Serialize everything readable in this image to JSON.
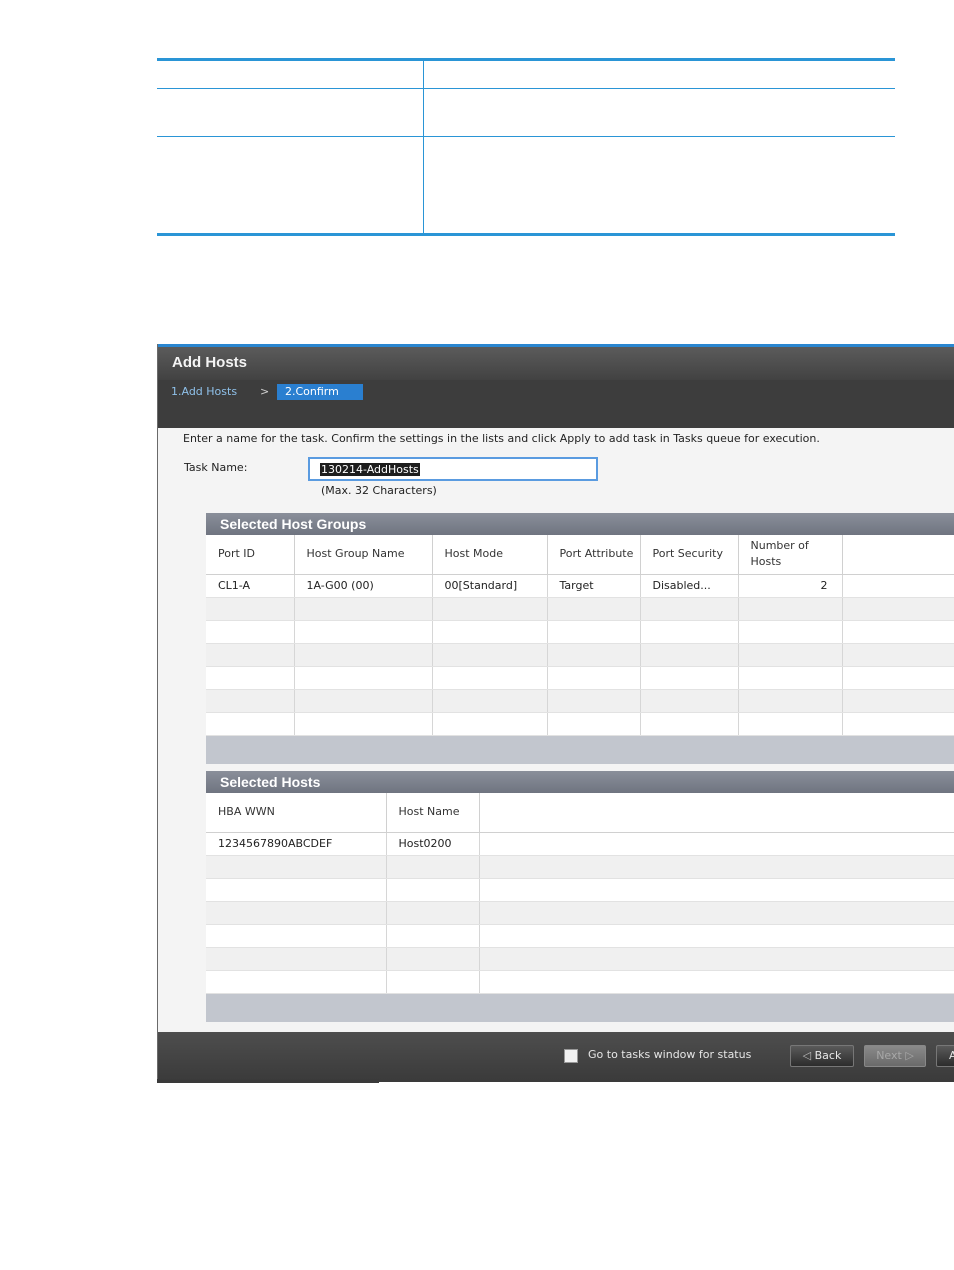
{
  "dialog": {
    "title": "Add Hosts",
    "steps": {
      "step1": "1.Add Hosts",
      "separator": ">",
      "step2": "2.Confirm"
    },
    "instruction": "Enter a name for the task. Confirm the settings in the lists and click Apply to add task in Tasks queue for execution.",
    "task_name_label": "Task Name:",
    "task_name_value": "130214-AddHosts",
    "max_note": "(Max. 32 Characters)"
  },
  "host_groups": {
    "title": "Selected Host Groups",
    "columns": [
      "Port ID",
      "Host Group Name",
      "Host Mode",
      "Port Attribute",
      "Port Security",
      "Number of Hosts"
    ],
    "rows": [
      [
        "CL1-A",
        "1A-G00 (00)",
        "00[Standard]",
        "Target",
        "Disabled...",
        "2"
      ]
    ]
  },
  "hosts": {
    "title": "Selected Hosts",
    "columns": [
      "HBA WWN",
      "Host Name"
    ],
    "rows": [
      [
        "1234567890ABCDEF",
        "Host0200"
      ]
    ]
  },
  "footer": {
    "checkbox_label": "Go to tasks window for status",
    "back_label": "Back",
    "next_label": "Next",
    "apply_label": "A"
  }
}
